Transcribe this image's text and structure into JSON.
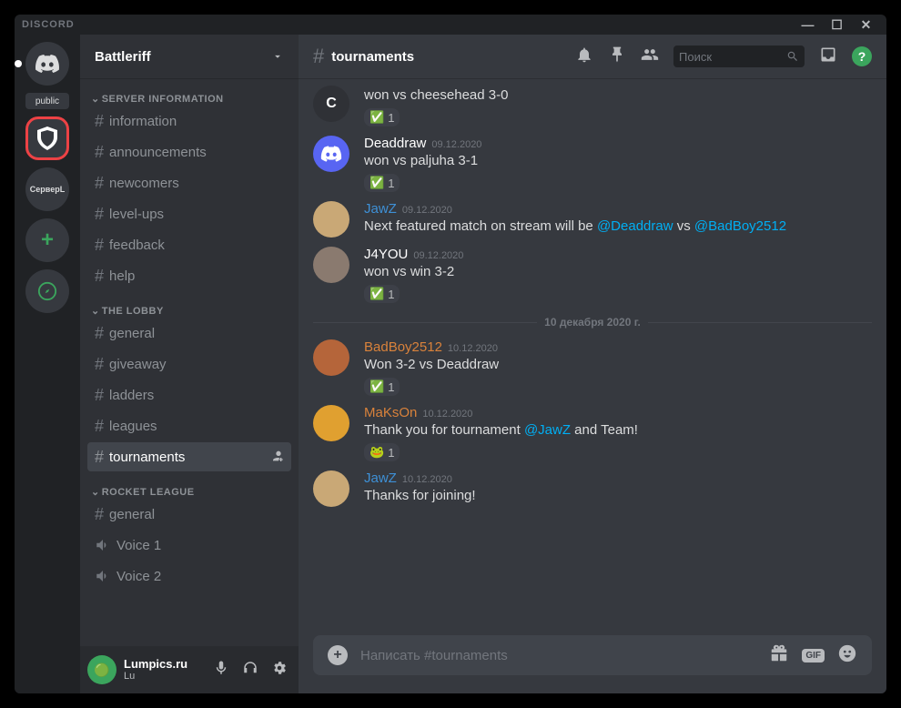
{
  "app_title": "DISCORD",
  "server_name": "Battleriff",
  "guilds": {
    "public_label": "public",
    "server2_label": "СерверL"
  },
  "categories": [
    {
      "name": "SERVER INFORMATION",
      "channels": [
        {
          "name": "information",
          "type": "text"
        },
        {
          "name": "announcements",
          "type": "text"
        },
        {
          "name": "newcomers",
          "type": "text"
        },
        {
          "name": "level-ups",
          "type": "text"
        },
        {
          "name": "feedback",
          "type": "text"
        },
        {
          "name": "help",
          "type": "text"
        }
      ]
    },
    {
      "name": "THE LOBBY",
      "channels": [
        {
          "name": "general",
          "type": "text"
        },
        {
          "name": "giveaway",
          "type": "text"
        },
        {
          "name": "ladders",
          "type": "text"
        },
        {
          "name": "leagues",
          "type": "text"
        },
        {
          "name": "tournaments",
          "type": "text",
          "active": true
        }
      ]
    },
    {
      "name": "ROCKET LEAGUE",
      "channels": [
        {
          "name": "general",
          "type": "text"
        },
        {
          "name": "Voice 1",
          "type": "voice"
        },
        {
          "name": "Voice 2",
          "type": "voice"
        }
      ]
    }
  ],
  "current_channel": "tournaments",
  "search_placeholder": "Поиск",
  "user": {
    "name": "Lumpics.ru",
    "sub": "Lu"
  },
  "divider_text": "10 декабря 2020 г.",
  "input_placeholder": "Написать #tournaments",
  "messages": [
    {
      "author": "C",
      "author_color": "#fff",
      "avatar_bg": "#2f3136",
      "avatar_text": "C",
      "content": "won vs cheesehead 3-0",
      "reaction_emoji": "✅",
      "reaction_count": "1",
      "hide_header": true
    },
    {
      "author": "Deaddraw",
      "author_color": "#fff",
      "avatar_bg": "#5865f2",
      "timestamp": "09.12.2020",
      "content": "won vs paljuha 3-1",
      "reaction_emoji": "✅",
      "reaction_count": "1"
    },
    {
      "author": "JawZ",
      "author_color": "#3e90d6",
      "avatar_bg": "#c9a876",
      "timestamp": "09.12.2020",
      "content_pre": "Next featured match on stream will be ",
      "mention1": "@Deaddraw",
      "content_mid": " vs ",
      "mention2": "@BadBoy2512"
    },
    {
      "author": "J4YOU",
      "author_color": "#fff",
      "avatar_bg": "#8a7a6f",
      "timestamp": "09.12.2020",
      "content": "won vs win 3-2",
      "reaction_emoji": "✅",
      "reaction_count": "1"
    },
    {
      "author": "BadBoy2512",
      "author_color": "#d9823b",
      "avatar_bg": "#b5653a",
      "timestamp": "10.12.2020",
      "content": "Won 3-2 vs Deaddraw",
      "reaction_emoji": "✅",
      "reaction_count": "1",
      "after_divider": true
    },
    {
      "author": "MaKsOn",
      "author_color": "#d9823b",
      "avatar_bg": "#e0a030",
      "timestamp": "10.12.2020",
      "content_pre": "Thank you for tournament ",
      "mention1": "@JawZ",
      "content_mid": " and Team!",
      "reaction_emoji": "🐸",
      "reaction_count": "1"
    },
    {
      "author": "JawZ",
      "author_color": "#3e90d6",
      "avatar_bg": "#c9a876",
      "timestamp": "10.12.2020",
      "content": "Thanks for joining!"
    }
  ],
  "gif_label": "GIF"
}
